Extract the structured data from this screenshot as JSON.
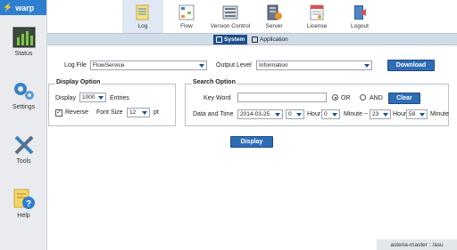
{
  "app": {
    "brand": "warp",
    "status_bar": "asteria-master : /asu"
  },
  "sidebar": {
    "items": [
      {
        "label": "Status",
        "icon": "chart-icon"
      },
      {
        "label": "Settings",
        "icon": "gears-icon"
      },
      {
        "label": "Tools",
        "icon": "tools-icon"
      },
      {
        "label": "Help",
        "icon": "help-icon"
      }
    ]
  },
  "topnav": {
    "items": [
      {
        "label": "Log",
        "icon": "log-icon",
        "active": true
      },
      {
        "label": "Flow",
        "icon": "flow-icon"
      },
      {
        "label": "Version Control",
        "icon": "version-control-icon"
      },
      {
        "label": "Server",
        "icon": "server-icon"
      },
      {
        "label": "License",
        "icon": "license-icon"
      },
      {
        "label": "Logout",
        "icon": "logout-icon"
      }
    ]
  },
  "subtabs": [
    {
      "label": "System",
      "active": true
    },
    {
      "label": "Application"
    }
  ],
  "form": {
    "log_file_label": "Log File",
    "log_file_value": "FlowService",
    "output_level_label": "Output Level",
    "output_level_value": "Information",
    "download_label": "Download",
    "display_option_title": "Display Option",
    "display_label": "Display",
    "display_value": "1000",
    "entries_label": "Entries",
    "reverse_label": "Reverse",
    "reverse_checked": true,
    "font_size_label": "Font Size",
    "font_size_value": "12",
    "pt_label": "pt",
    "search_option_title": "Search Option",
    "keyword_label": "Key Word",
    "keyword_value": "",
    "or_label": "OR",
    "and_label": "AND",
    "clear_label": "Clear",
    "date_time_label": "Data and Time",
    "date_value": "2014-03-25",
    "hour1_value": "0",
    "hour_label": "Hour",
    "minute1_value": "0",
    "minute_dash_label": "Minute --",
    "hour2_value": "23",
    "minute2_value": "59",
    "minute_label": "Minute",
    "display_button_label": "Display"
  },
  "colors": {
    "accent": "#2f6db5",
    "subbar": "#d1dce9",
    "sidebar": "#e9ebee"
  }
}
